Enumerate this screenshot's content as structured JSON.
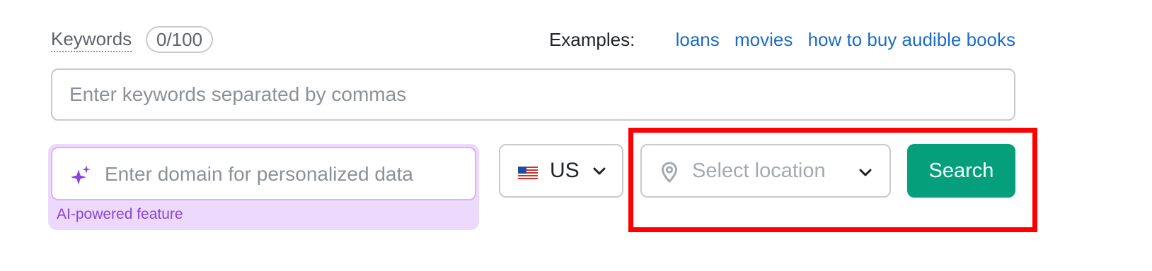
{
  "keywords": {
    "label": "Keywords",
    "counter": "0/100",
    "placeholder": "Enter keywords separated by commas"
  },
  "examples": {
    "label": "Examples:",
    "links": [
      "loans",
      "movies",
      "how to buy audible books"
    ]
  },
  "domain_field": {
    "icon": "sparkle-icon",
    "placeholder": "Enter domain for personalized data",
    "caption": "AI-powered feature"
  },
  "country": {
    "icon": "us-flag-icon",
    "code": "US"
  },
  "location": {
    "icon": "map-pin-icon",
    "placeholder": "Select location"
  },
  "search_button": {
    "label": "Search"
  },
  "colors": {
    "accent": "#05a07b",
    "link": "#1b6cc7",
    "ai_purple": "#8a45d6",
    "ai_bg": "#ecd9fc",
    "highlight": "#ff0000"
  }
}
